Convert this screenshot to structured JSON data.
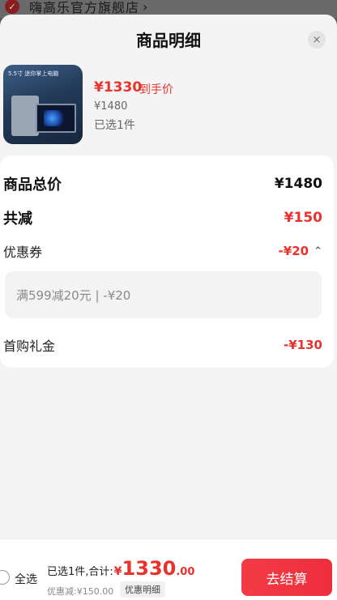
{
  "store": {
    "name": "嗨高乐官方旗舰店",
    "chevron": "›"
  },
  "sheet": {
    "title": "商品明细",
    "close_icon": "×"
  },
  "product": {
    "thumb_text": "5.5寸 迷你掌上电脑",
    "price": "¥1330",
    "price_tag": "到手价",
    "original_price": "¥1480",
    "selected": "已选1件"
  },
  "summary": {
    "total_label": "商品总价",
    "total_value": "¥1480",
    "discount_label": "共减",
    "discount_value": "¥150",
    "coupon_label": "优惠券",
    "coupon_value": "-¥20",
    "coupon_detail": "满599减20元 | -¥20",
    "gift_label": "首购礼金",
    "gift_value": "-¥130"
  },
  "bottom": {
    "select_all": "全选",
    "sum_label": "已选1件,合计:",
    "currency": "¥",
    "amount_int": "1330",
    "amount_dec": ".00",
    "saved": "优惠减:¥150.00",
    "detail_button": "优惠明细",
    "checkout_button": "去结算"
  },
  "colors": {
    "accent": "#e8322d",
    "checkout": "#f23b46"
  }
}
